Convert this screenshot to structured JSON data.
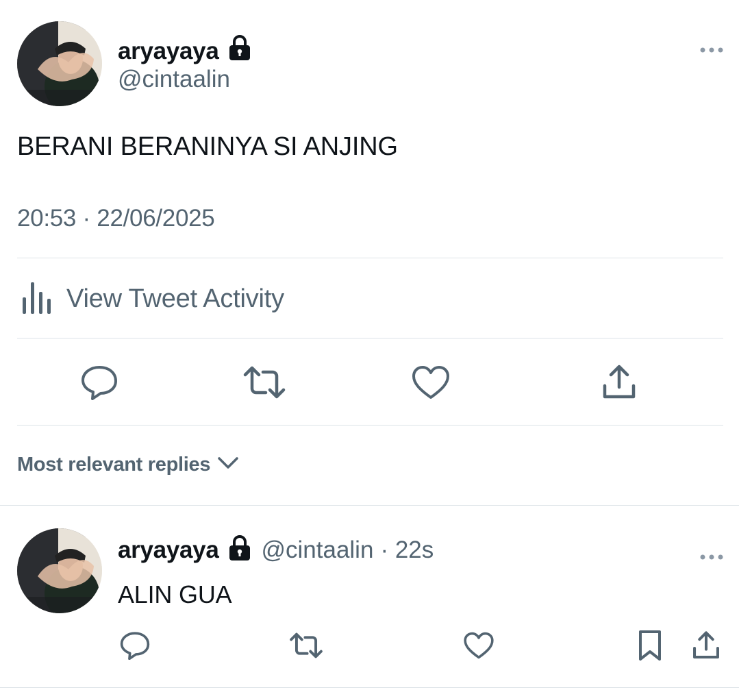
{
  "main_tweet": {
    "author": {
      "display_name": "aryayaya",
      "handle": "@cintaalin",
      "avatar": "user-avatar",
      "protected_icon": "lock-icon"
    },
    "more_icon": "more-options-icon",
    "text": "BERANI BERANINYA SI ANJING",
    "timestamp": "20:53 · 22/06/2025",
    "activity": {
      "icon": "bar-chart-icon",
      "label": "View Tweet Activity"
    },
    "actions": [
      {
        "name": "reply",
        "icon": "reply-icon"
      },
      {
        "name": "retweet",
        "icon": "retweet-icon"
      },
      {
        "name": "like",
        "icon": "heart-icon"
      },
      {
        "name": "share",
        "icon": "share-icon"
      }
    ]
  },
  "replies_sort": {
    "label": "Most relevant replies",
    "icon": "chevron-down-icon"
  },
  "reply": {
    "author": {
      "display_name": "aryayaya",
      "handle": "@cintaalin",
      "age": "· 22s",
      "protected_icon": "lock-icon"
    },
    "text": "ALIN GUA",
    "actions": [
      {
        "name": "reply",
        "icon": "reply-icon"
      },
      {
        "name": "retweet",
        "icon": "retweet-icon"
      },
      {
        "name": "like",
        "icon": "heart-icon"
      },
      {
        "name": "bookmark",
        "icon": "bookmark-icon"
      },
      {
        "name": "share",
        "icon": "share-icon"
      }
    ]
  },
  "colors": {
    "text_primary": "#0f1419",
    "text_secondary": "#536471",
    "divider": "#dde3e8"
  }
}
